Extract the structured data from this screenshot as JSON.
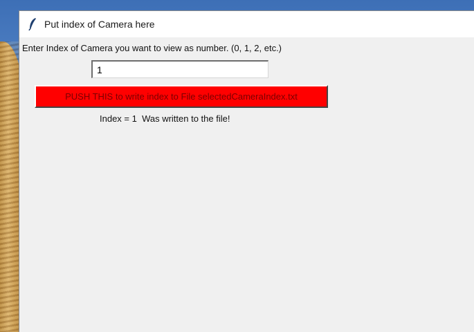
{
  "window": {
    "title": "Put index of Camera here",
    "icon": "feather-icon"
  },
  "form": {
    "prompt": "Enter Index of Camera you want to view as number. (0, 1, 2, etc.)",
    "index_value": "1",
    "push_button_label": "PUSH THIS to write index to File selectedCameraIndex.txt",
    "status": "Index = 1  Was written to the file!"
  },
  "colors": {
    "button_bg": "#ff0000",
    "window_bg": "#f0f0f0"
  }
}
